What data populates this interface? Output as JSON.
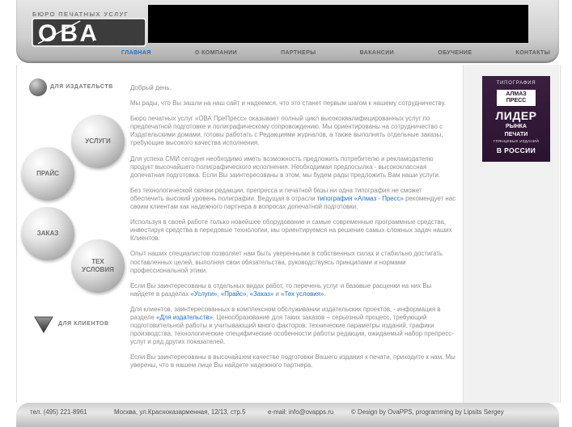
{
  "header": {
    "tagline": "БЮРО ПЕЧАТНЫХ УСЛУГ",
    "logo_main": "ОВА",
    "logo_sub": "ПРЕ ПРЕСС"
  },
  "nav": [
    {
      "label": "ГЛАВНАЯ",
      "active": true
    },
    {
      "label": "О КОМПАНИИ",
      "active": false
    },
    {
      "label": "ПАРТНЕРЫ",
      "active": false
    },
    {
      "label": "ВАКАНСИИ",
      "active": false
    },
    {
      "label": "ОБУЧЕНИЕ",
      "active": false
    },
    {
      "label": "КОНТАКТЫ",
      "active": false
    }
  ],
  "sidebar": {
    "publishers_label": "ДЛЯ ИЗДАТЕЛЬСТВ",
    "clients_label": "ДЛЯ КЛИЕНТОВ",
    "buttons": {
      "services": "УСЛУГИ",
      "price": "ПРАЙС",
      "order": "ЗАКАЗ",
      "tech_line1": "ТЕХ",
      "tech_line2": "УСЛОВИЯ"
    }
  },
  "content": {
    "greeting": "Добрый день.",
    "p1": "Мы рады, что Вы зашли на наш сайт и надеемся, что это станет первым шагом к нашему сотрудничеству.",
    "p2": "Бюро печатных услуг «ОВА ПреПресс» оказывает полный цикл высококвалифицированных услуг по предпечатной подготовке и полиграфическому сопровождению. Мы ориентированы на сотрудничество с Издательскими домами, готовы работать с Редакциями журналов, а также выполнять отдельные заказы, требующие высокого качества исполнения.",
    "p3": "Для успеха СМИ сегодня необходимо иметь возможность предложить потребителю и рекламодателю продукт высочайшего полиграфического исполнения. Необходимая предпосылка - высококлассная допечатная подготовка. Если Вы заинтересованы в этом, мы будем рады предложить Вам наши услуги.",
    "p4_a": "Без технологической связки редакции, препресса и печатной базы ни одна типография не сможет обеспечить высокий уровень полиграфии. Ведущая в отрасли ",
    "p4_link": "типография «Алмаз - Пресс»",
    "p4_b": " рекомендует нас своим клиентам как надежного партнера в вопросах допечатной подготовки.",
    "p5": "Используя в своей работе только новейшее оборудование и самые современные программные средства, инвестируя средства в передовые технологии, мы ориентируемся на решение самых сложных задач наших Клиентов.",
    "p6": "Опыт наших специалистов позволяет нам быть уверенными в собственных силах и стабильно достигать поставленных целей, выполняя свои обязательства, руководствуясь принципами и нормами профессиональной этики.",
    "p7_a": "Если Вы заинтересованы в отдельных видах работ, то перечень услуг и базовые расценки на них Вы найдете в разделах ",
    "p7_l1": "«Услуги»",
    "p7_s1": ", ",
    "p7_l2": "«Прайс»",
    "p7_s2": ", ",
    "p7_l3": "«Заказ»",
    "p7_s3": " и ",
    "p7_l4": "«Тех условия»",
    "p7_end": ".",
    "p8_a": "Для клиентов, заинтересованных в комплексном обслуживании издательских проектов, - информация в разделе ",
    "p8_link": "«Для издательств»",
    "p8_b": ". Ценообразование для таких заказов – серьезный процесс, требующий подготовительной работы и учитывающий много факторов: технические параметры изданий, графики производства, технологические специфические особенности работы редакции, ожидаемый набор препресс-услуг и ряд других показателей.",
    "p9": "Если Вы заинтересованы в высочайшем качестве подготовки Вашего издания к печати, приходите к нам. Мы уверены, что в нашем лице Вы найдете надежного партнера."
  },
  "promo": {
    "label": "ТИПОГРАФИЯ",
    "brand_line1": "АЛМАЗ",
    "brand_line2": "ПРЕСС",
    "headline": "ЛИДЕР",
    "line1": "РЫНКА",
    "line2": "ПЕЧАТИ",
    "line3": "ГЛЯНЦЕВЫХ ИЗДАНИЙ",
    "line4": "В РОССИИ"
  },
  "footer": {
    "phone": "тел. (495) 221-8961",
    "address": "Москва, ул.Красноказарменная, 12/13, стр.5",
    "email": "e-mail: info@ovapps.ru",
    "credits": "© Design by OvaPPS, programming by Lipsits Sergey"
  },
  "colors": {
    "accent": "#1f6fc8",
    "text": "#8c8c8c",
    "promo_bg": "#2b1330"
  }
}
